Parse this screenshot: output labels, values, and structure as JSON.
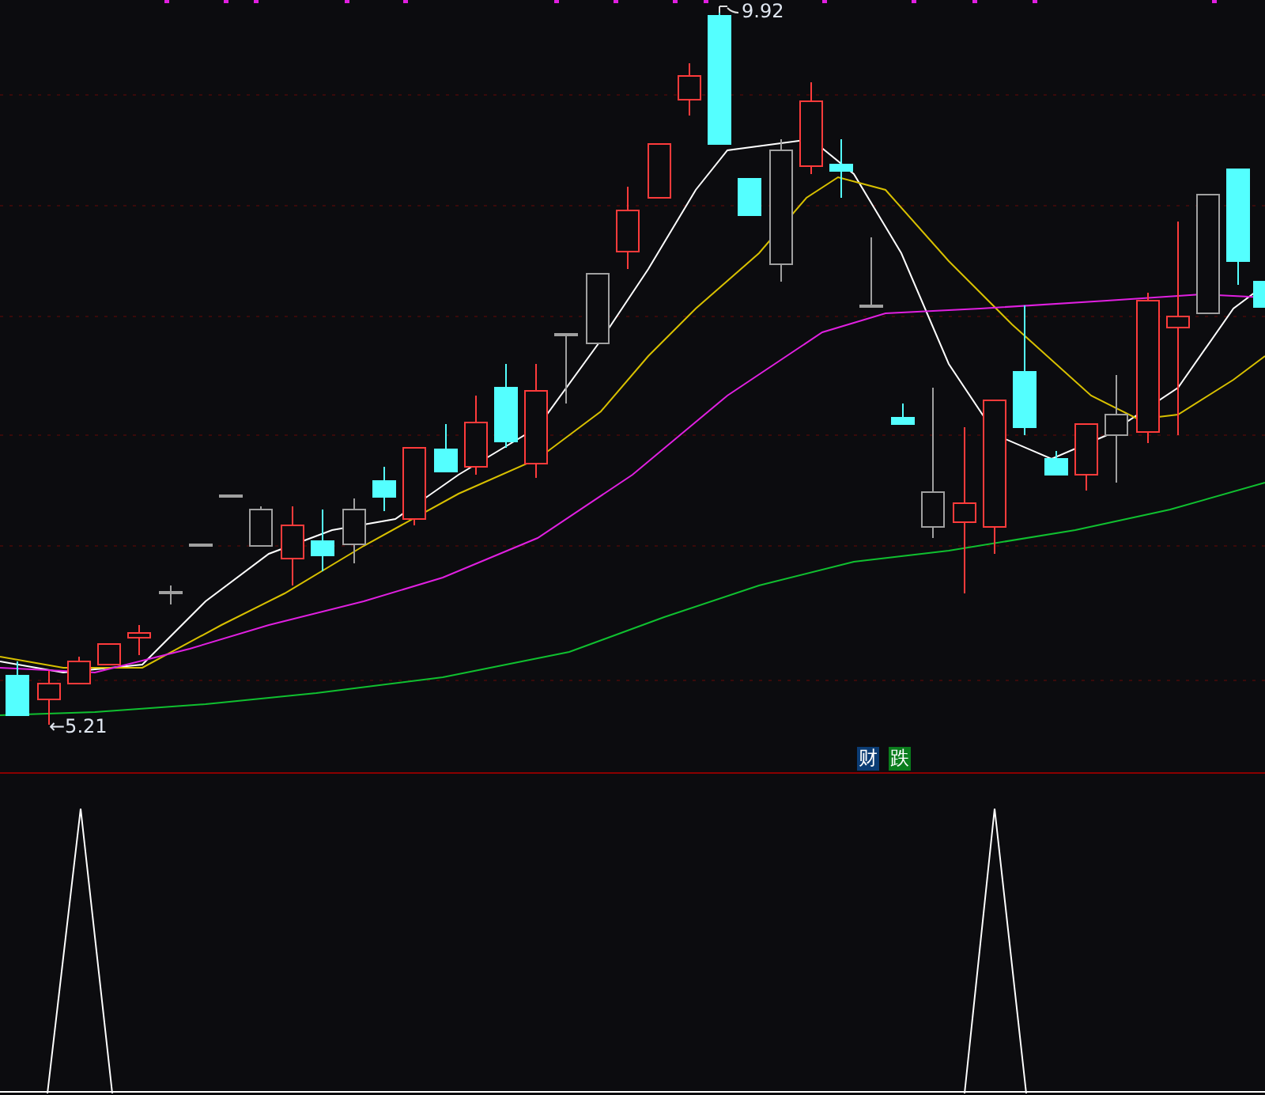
{
  "price_chart": {
    "high_label": "9.92",
    "low_label": "←5.21"
  },
  "signal_badges": [
    {
      "text": "财",
      "color": "#0b3c74"
    },
    {
      "text": "跌",
      "color": "#0a7d1c"
    }
  ]
}
